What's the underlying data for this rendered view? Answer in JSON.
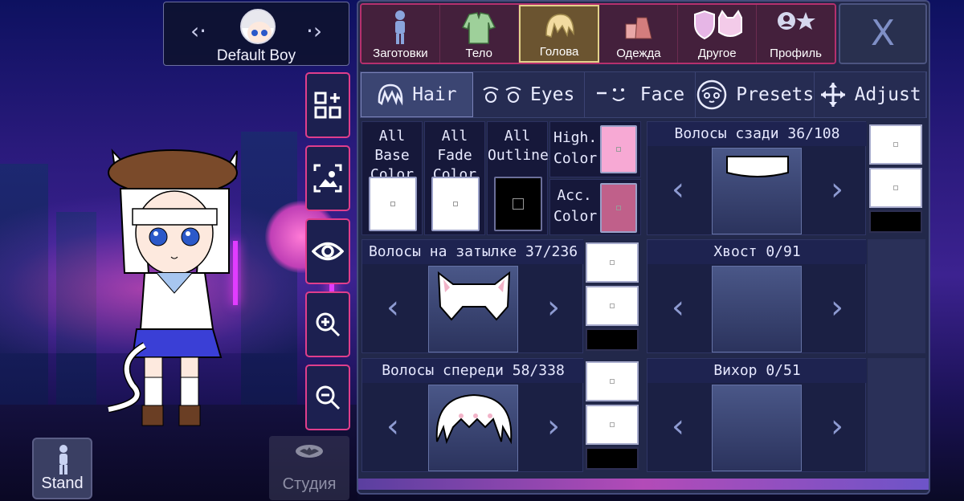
{
  "character": {
    "name": "Default Boy",
    "prev_glyph": "‹·",
    "next_glyph": "·›"
  },
  "tools": [
    {
      "name": "add-grid-icon"
    },
    {
      "name": "background-image-icon"
    },
    {
      "name": "eye-icon"
    },
    {
      "name": "zoom-in-icon"
    },
    {
      "name": "zoom-out-icon"
    }
  ],
  "stand_label": "Stand",
  "studio_label": "Студия",
  "tabs": [
    {
      "label": "Заготовки",
      "icon": "preset-figure-icon"
    },
    {
      "label": "Тело",
      "icon": "jacket-icon"
    },
    {
      "label": "Голова",
      "icon": "hair-head-icon",
      "active": true
    },
    {
      "label": "Одежда",
      "icon": "clothes-icon"
    },
    {
      "label": "Другое",
      "icon": "shield-cat-icon"
    },
    {
      "label": "Профиль",
      "icon": "profile-star-icon"
    }
  ],
  "close_glyph": "X",
  "subtabs": [
    {
      "label": "Hair",
      "icon": "hair-icon",
      "active": true
    },
    {
      "label": "Eyes",
      "icon": "eyes-icon"
    },
    {
      "label": "Face",
      "icon": "face-icon"
    },
    {
      "label": "Presets",
      "icon": "presets-face-icon"
    },
    {
      "label": "Adjust",
      "icon": "move-arrows-icon"
    }
  ],
  "colors": {
    "all_base_l1": "All Base",
    "all_base_l2": "Color",
    "all_fade_l1": "All Fade",
    "all_fade_l2": "Color",
    "all_outline_l1": "All",
    "all_outline_l2": "Outline",
    "high_l1": "High.",
    "high_l2": "Color",
    "acc_l1": "Acc.",
    "acc_l2": "Color",
    "base_hex": "#ffffff",
    "fade_hex": "#ffffff",
    "outline_hex": "#000000",
    "high_hex": "#f7a9d4",
    "acc_hex": "#c0608a"
  },
  "sections": {
    "back_hair": "Волосы сзади 36/108",
    "rear_hair": "Волосы на затылке 37/236",
    "tail": "Хвост 0/91",
    "front_hair": "Волосы спереди 58/338",
    "ahoge": "Вихор 0/51"
  },
  "arrow_left": "‹",
  "arrow_right": "›"
}
